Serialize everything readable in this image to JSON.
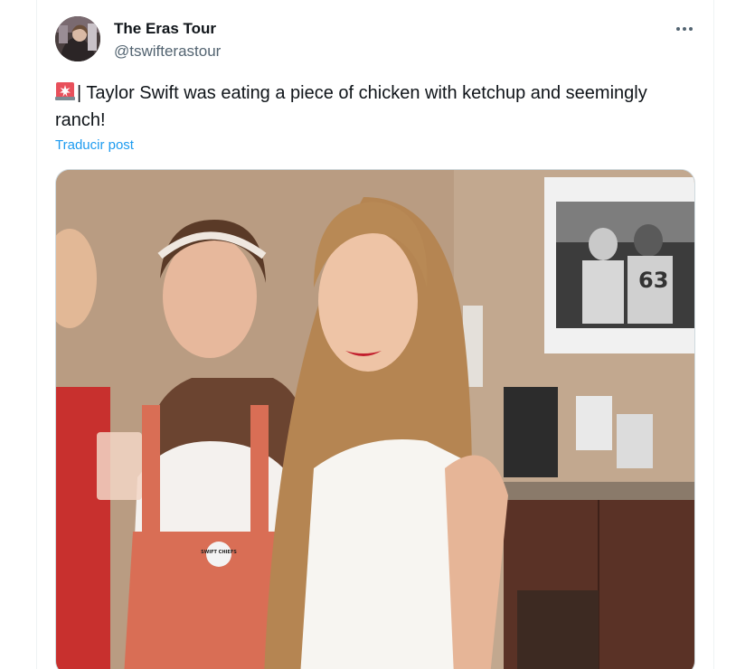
{
  "tweet": {
    "author": {
      "display_name": "The Eras Tour",
      "handle": "@tswifterastour",
      "avatar_icon": "profile-avatar"
    },
    "more_icon": "more-options-icon",
    "text": {
      "emoji_icon": "police-siren-emoji",
      "body": "| Taylor Swift was eating a piece of chicken with ketchup and seemingly ranch!"
    },
    "translate_label": "Traducir post",
    "media": {
      "type": "photo",
      "pin_text": "SWIFT CHIEFS",
      "jersey_number": "63"
    }
  },
  "colors": {
    "link": "#1d9bf0",
    "secondary_text": "#536471",
    "primary_text": "#0f1419",
    "border": "#cfd9de"
  }
}
